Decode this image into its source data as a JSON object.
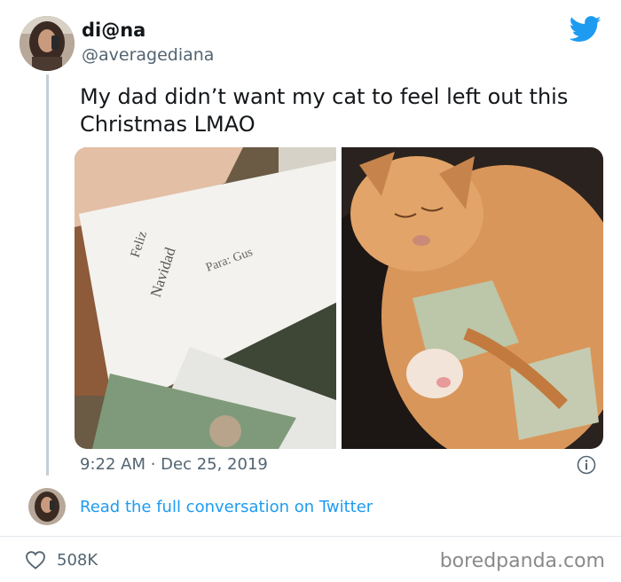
{
  "tweet": {
    "display_name": "di@na",
    "handle": "@averagediana",
    "text": "My dad didn’t want my cat to feel left out this Christmas LMAO",
    "timestamp": "9:22 AM · Dec 25, 2019",
    "media": [
      {
        "subject": "envelope-with-money"
      },
      {
        "subject": "sleeping-orange-cat-with-money"
      }
    ]
  },
  "handwriting": {
    "line1": "Feliz",
    "line2": "Navidad",
    "line3": "Para: Gus"
  },
  "thread": {
    "link_text": "Read the full conversation on Twitter"
  },
  "actions": {
    "like_count": "508K"
  },
  "watermark": "boredpanda.com",
  "colors": {
    "twitter_blue": "#1d9bf0",
    "text_primary": "#14171a",
    "text_secondary": "#536471"
  },
  "icons": [
    "twitter-bird-icon",
    "info-icon",
    "heart-icon"
  ]
}
